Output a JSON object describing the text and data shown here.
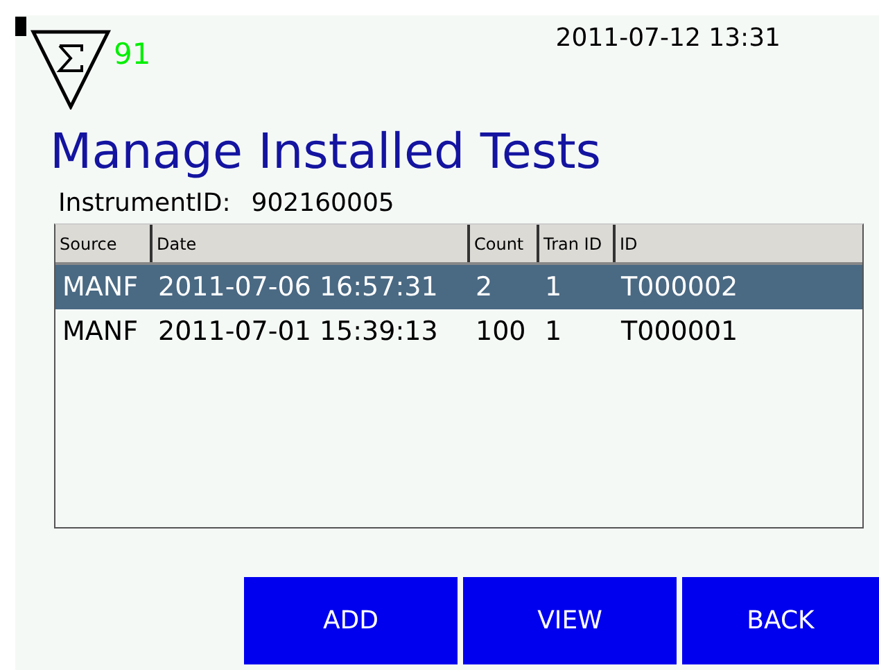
{
  "header": {
    "badge": "91",
    "datetime": "2011-07-12 13:31"
  },
  "title": "Manage Installed Tests",
  "instrument": {
    "label": "InstrumentID:",
    "value": "902160005"
  },
  "table": {
    "columns": [
      "Source",
      "Date",
      "Count",
      "Tran ID",
      "ID"
    ],
    "rows": [
      {
        "cells": [
          "MANF",
          "2011-07-06 16:57:31",
          "2",
          "1",
          "T000002"
        ],
        "selected": true
      },
      {
        "cells": [
          "MANF",
          "2011-07-01 15:39:13",
          "100",
          "1",
          "T000001"
        ],
        "selected": false
      }
    ]
  },
  "buttons": [
    "ADD",
    "VIEW",
    "BACK"
  ]
}
